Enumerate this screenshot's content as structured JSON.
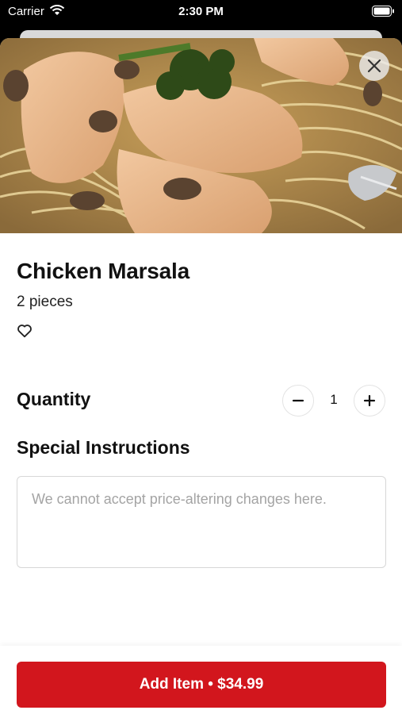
{
  "status_bar": {
    "carrier": "Carrier",
    "time": "2:30 PM",
    "icons": [
      "wifi-icon",
      "battery-icon"
    ]
  },
  "item": {
    "name": "Chicken Marsala",
    "description": "2 pieces",
    "image_icon": "food-photo",
    "favorite_icon": "heart-outline-icon"
  },
  "quantity": {
    "label": "Quantity",
    "value": "1",
    "decrement_icon": "minus-icon",
    "increment_icon": "plus-icon"
  },
  "special_instructions": {
    "label": "Special Instructions",
    "value": "",
    "placeholder": "We cannot accept price-altering changes here."
  },
  "footer": {
    "add_button_label": "Add Item • $34.99"
  },
  "close_icon": "close-icon",
  "colors": {
    "accent": "#d2161d",
    "text": "#111111",
    "placeholder": "#a4a4a4",
    "border": "#d7d7d7"
  }
}
